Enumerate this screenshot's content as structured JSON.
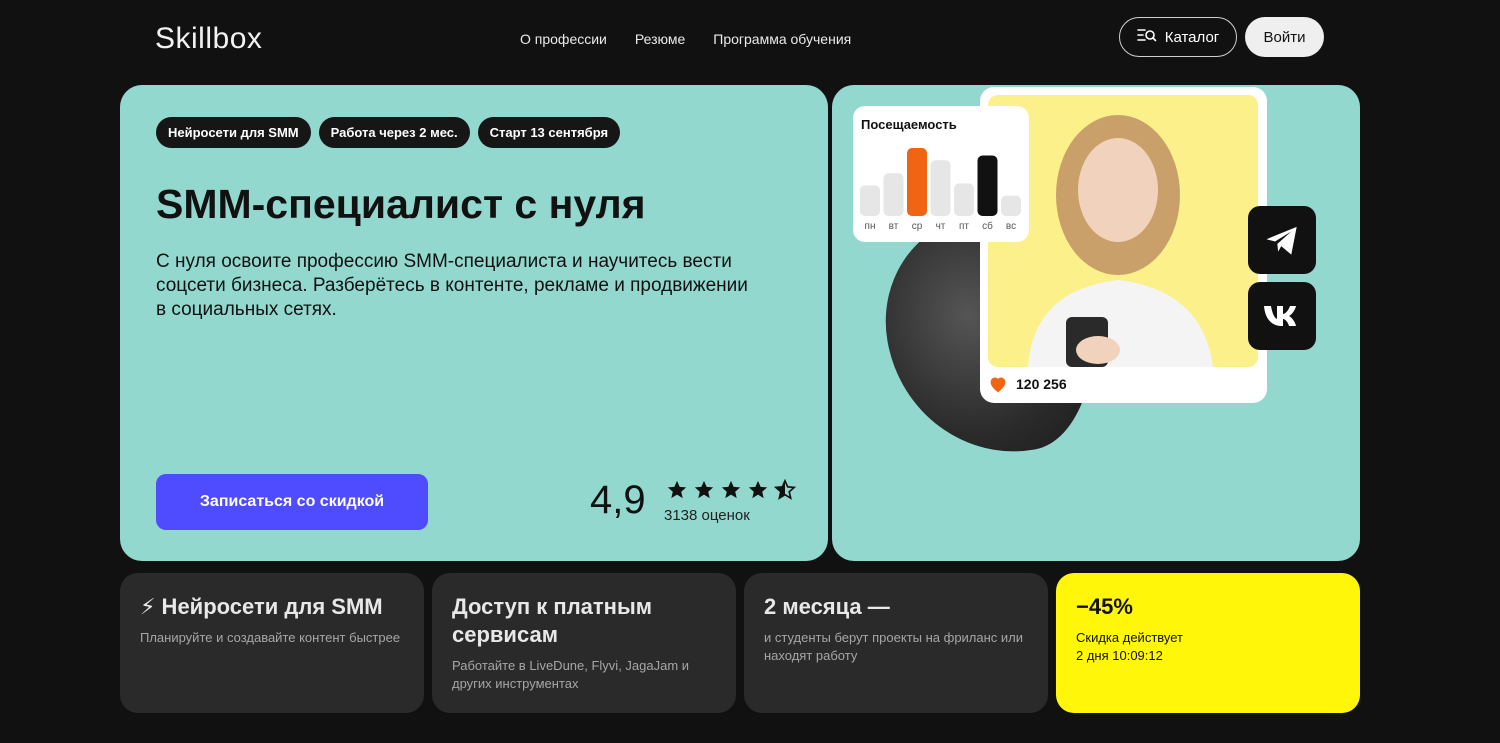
{
  "header": {
    "logo": "Skillbox",
    "nav": [
      "О профессии",
      "Резюме",
      "Программа обучения"
    ],
    "catalog_label": "Каталог",
    "login_label": "Войти"
  },
  "hero": {
    "tags": [
      "Нейросети для SMM",
      "Работа через 2 мес.",
      "Старт 13 сентября"
    ],
    "title": "SMM-специалист с нуля",
    "description": "С нуля освоите профессию SMM-специалиста и научитесь вести соцсети бизнеса. Разберётесь в контенте, рекламе и продвижении в социальных сетях.",
    "cta": "Записаться со скидкой",
    "rating": "4,9",
    "rating_stars": 4.5,
    "rating_count": "3138 оценок"
  },
  "visual": {
    "stats_title": "Посещаемость",
    "days": [
      "пн",
      "вт",
      "ср",
      "чт",
      "пт",
      "сб",
      "вс"
    ],
    "bar_levels": [
      0.45,
      0.63,
      1.0,
      0.82,
      0.48,
      0.89,
      0.3
    ],
    "likes": "120 256",
    "social_icons": [
      "telegram-icon",
      "vk-icon"
    ],
    "colors": {
      "accent_bar": "#f06414",
      "dark_bar": "#111111",
      "light_bar": "#e6e6e6",
      "heart": "#f06414"
    }
  },
  "features": [
    {
      "title": "⚡ Нейросети для SMM",
      "text": "Планируйте и создавайте контент быстрее"
    },
    {
      "title": "Доступ к платным сервисам",
      "text": "Работайте в LiveDune, Flyvi, JagaJam и других инструментах"
    },
    {
      "title": "2 месяца —",
      "text": "и студенты берут проекты на фриланс или находят работу"
    },
    {
      "title": "−45%",
      "text": "Скидка действует",
      "timer": "2 дня 10:09:12"
    }
  ],
  "colors": {
    "page_bg": "#111111",
    "hero_bg": "#92d8cf",
    "cta": "#4f4bff",
    "card_bg": "#2a2a2a",
    "promo": "#fff60a"
  }
}
